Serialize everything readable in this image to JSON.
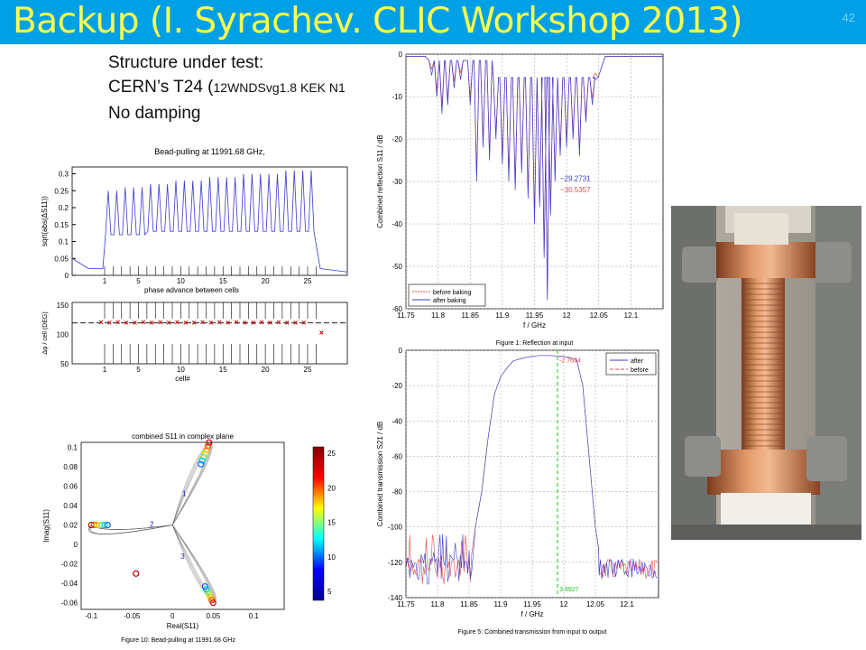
{
  "header": {
    "title": "Backup (I. Syrachev. CLIC Workshop 2013)",
    "slide_number": "42"
  },
  "bullets": {
    "line1": "Structure under test:",
    "line2_main": "CERN’s T24 (",
    "line2_small": "12WNDSvg1.8 KEK N1",
    "line3": "No damping"
  },
  "colors": {
    "title_bar": "#00a0e6",
    "title_text": "#ffff4d",
    "before": "#e34c4c",
    "after": "#3a3ad0",
    "marker": "#c00000"
  },
  "chart_data": [
    {
      "type": "line",
      "title": "Bead-pulling at 11991.68 GHz,",
      "xlabel": "phase advance between cells",
      "ylabel": "sqrt(abs(ΔS11))",
      "x_tick_labels": [
        "1",
        "5",
        "10",
        "15",
        "20",
        "25"
      ],
      "yticks": [
        0,
        0.05,
        0.1,
        0.15,
        0.2,
        0.25,
        0.3
      ],
      "ylim": [
        0,
        0.32
      ],
      "series": [
        {
          "name": "",
          "peaks": [
            0.25,
            0.25,
            0.26,
            0.26,
            0.26,
            0.27,
            0.27,
            0.27,
            0.28,
            0.28,
            0.28,
            0.28,
            0.29,
            0.29,
            0.29,
            0.29,
            0.3,
            0.3,
            0.3,
            0.3,
            0.3,
            0.31,
            0.31,
            0.31,
            0.31
          ],
          "troughs": [
            0.12,
            0.12,
            0.12,
            0.12,
            0.12,
            0.13,
            0.13,
            0.13,
            0.13,
            0.13,
            0.13,
            0.13,
            0.13,
            0.13,
            0.13,
            0.13,
            0.13,
            0.13,
            0.13,
            0.13,
            0.13,
            0.13,
            0.13,
            0.13,
            0.13
          ],
          "baseline": 0.02
        }
      ]
    },
    {
      "type": "scatter",
      "xlabel": "cell#",
      "ylabel": "Δφ / cell (DEG)",
      "x_tick_labels": [
        "1",
        "5",
        "10",
        "15",
        "20",
        "25"
      ],
      "yticks": [
        50,
        100,
        150
      ],
      "ylim": [
        50,
        155
      ],
      "reference_line": 120,
      "series": [
        {
          "name": "",
          "x": [
            1,
            2,
            3,
            4,
            5,
            6,
            7,
            8,
            9,
            10,
            11,
            12,
            13,
            14,
            15,
            16,
            17,
            18,
            19,
            20,
            21,
            22,
            23,
            24,
            25,
            26
          ],
          "y": [
            121,
            120,
            121,
            120,
            120,
            121,
            120,
            121,
            120,
            121,
            120,
            120,
            121,
            120,
            121,
            120,
            121,
            120,
            120,
            121,
            120,
            121,
            120,
            120,
            120,
            103
          ]
        }
      ]
    },
    {
      "type": "line",
      "title": "",
      "xlabel": "f / GHz",
      "ylabel": "Combined reflection S11 / dB",
      "xlim": [
        11.75,
        12.15
      ],
      "ylim": [
        -60,
        0
      ],
      "x_tick_labels": [
        "11.75",
        "11.8",
        "11.85",
        "11.9",
        "11.95",
        "12",
        "12.05",
        "12.1"
      ],
      "yticks": [
        0,
        -10,
        -20,
        -30,
        -40,
        -50,
        -60
      ],
      "annotations": [
        "~29.2731",
        "~30.5357"
      ],
      "series": [
        {
          "name": "before baking"
        },
        {
          "name": "after baking"
        }
      ],
      "caption": "Figure 1: Reflection at input"
    },
    {
      "type": "line",
      "title": "",
      "xlabel": "f / GHz",
      "ylabel": "Combined transmission S21 / dB",
      "xlim": [
        11.75,
        12.15
      ],
      "ylim": [
        -140,
        0
      ],
      "x_tick_labels": [
        "11.75",
        "11.8",
        "11.85",
        "11.9",
        "11.95",
        "12",
        "12.05",
        "12.1"
      ],
      "yticks": [
        0,
        -20,
        -40,
        -60,
        -80,
        -100,
        -120,
        -140
      ],
      "annotations": [
        "-2.7644",
        "3.9927"
      ],
      "series": [
        {
          "name": "after"
        },
        {
          "name": "before"
        }
      ],
      "caption": "Figure 5: Combined transmission from input to output"
    },
    {
      "type": "scatter",
      "title": "combined S11 in complex plane",
      "xlabel": "Real(S11)",
      "ylabel": "Imag(S11)",
      "xlim": [
        -0.1,
        0.1
      ],
      "ylim": [
        -0.06,
        0.1
      ],
      "x_tick_labels": [
        "-0.1",
        "-0.05",
        "0",
        "0.05",
        "0.1"
      ],
      "y_tick_labels": [
        "0.1",
        "0.08",
        "0.06",
        "0.04",
        "0.02",
        "0",
        "-0.02",
        "-0.04",
        "-0.06"
      ],
      "region_labels": [
        "1",
        "2",
        "3"
      ],
      "colorbar_ticks": [
        "25",
        "20",
        "15",
        "10",
        "5"
      ],
      "caption": "Figure 10: Bead-pulling at 11991.68 GHz"
    }
  ]
}
